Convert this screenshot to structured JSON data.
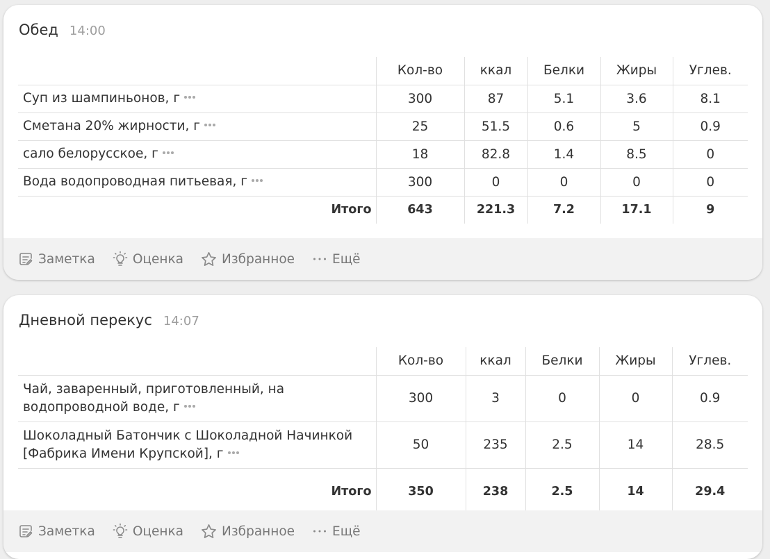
{
  "meals": [
    {
      "title": "Обед",
      "time": "14:00",
      "columns": [
        "Кол-во",
        "ккал",
        "Белки",
        "Жиры",
        "Углев."
      ],
      "rows": [
        {
          "name": "Суп из шампиньонов, г",
          "qty": "300",
          "kcal": "87",
          "protein": "5.1",
          "fat": "3.6",
          "carbs": "8.1"
        },
        {
          "name": "Сметана 20% жирности, г",
          "qty": "25",
          "kcal": "51.5",
          "protein": "0.6",
          "fat": "5",
          "carbs": "0.9"
        },
        {
          "name": "сало белорусское, г",
          "qty": "18",
          "kcal": "82.8",
          "protein": "1.4",
          "fat": "8.5",
          "carbs": "0"
        },
        {
          "name": "Вода водопроводная питьевая, г",
          "qty": "300",
          "kcal": "0",
          "protein": "0",
          "fat": "0",
          "carbs": "0"
        }
      ],
      "total": {
        "label": "Итого",
        "qty": "643",
        "kcal": "221.3",
        "protein": "7.2",
        "fat": "17.1",
        "carbs": "9"
      },
      "actions": {
        "note": "Заметка",
        "rating": "Оценка",
        "favorite": "Избранное",
        "more": "Ещё"
      }
    },
    {
      "title": "Дневной перекус",
      "time": "14:07",
      "columns": [
        "Кол-во",
        "ккал",
        "Белки",
        "Жиры",
        "Углев."
      ],
      "rows": [
        {
          "name": "Чай, заваренный, приготовленный, на водопроводной воде, г",
          "qty": "300",
          "kcal": "3",
          "protein": "0",
          "fat": "0",
          "carbs": "0.9"
        },
        {
          "name": "Шоколадный Батончик с Шоколадной Начинкой [Фабрика Имени Крупской], г",
          "qty": "50",
          "kcal": "235",
          "protein": "2.5",
          "fat": "14",
          "carbs": "28.5"
        }
      ],
      "total": {
        "label": "Итого",
        "qty": "350",
        "kcal": "238",
        "protein": "2.5",
        "fat": "14",
        "carbs": "29.4"
      },
      "actions": {
        "note": "Заметка",
        "rating": "Оценка",
        "favorite": "Избранное",
        "more": "Ещё"
      }
    }
  ],
  "colors": {
    "page_bg": "#eeeeee",
    "card_bg": "#ffffff",
    "action_bar_bg": "#f2f2f2",
    "text": "#333333",
    "muted": "#9e9e9e",
    "divider": "#e0e0e0"
  },
  "icons": {
    "note": "note-icon",
    "rating": "lightbulb-icon",
    "favorite": "star-icon",
    "more": "ellipsis-icon",
    "item_more": "more-dots-icon"
  }
}
